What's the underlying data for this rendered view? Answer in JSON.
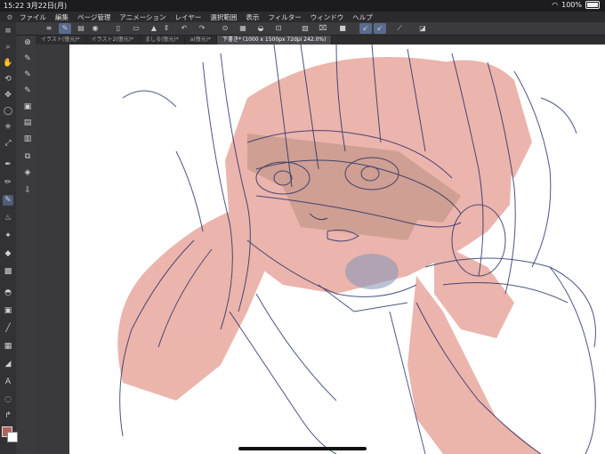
{
  "status": {
    "time": "15:22",
    "date": "3月22日(月)",
    "battery": "100%"
  },
  "menu": [
    "ファイル",
    "編集",
    "ページ管理",
    "アニメーション",
    "レイヤー",
    "選択範囲",
    "表示",
    "フィルター",
    "ウィンドウ",
    "ヘルプ"
  ],
  "tabs": [
    {
      "label": "イラスト(復元)*"
    },
    {
      "label": "イラスト2(復元)*"
    },
    {
      "label": "ましる(復元)*"
    },
    {
      "label": "a(復元)*"
    },
    {
      "label": "下書き* (1000 x 1500px 72dpi 242.0%)"
    }
  ],
  "colors": {
    "main_color": "#b5645a",
    "sub_color": "#ffffff",
    "accent": "#5a6b8c"
  }
}
